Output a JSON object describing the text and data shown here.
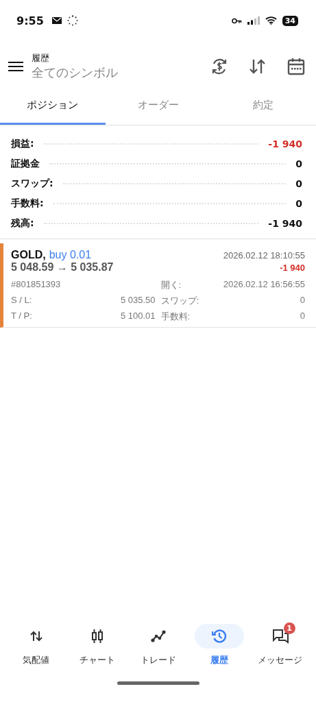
{
  "status_bar": {
    "time": "9:55",
    "battery": "34"
  },
  "header": {
    "title": "履歴",
    "subtitle": "全てのシンボル"
  },
  "tabs": [
    {
      "label": "ポジション",
      "selected": true
    },
    {
      "label": "オーダー",
      "selected": false
    },
    {
      "label": "約定",
      "selected": false
    }
  ],
  "summary": [
    {
      "label": "損益:",
      "value": "-1 940",
      "kind": "loss"
    },
    {
      "label": "証拠金",
      "value": "0",
      "kind": "plain"
    },
    {
      "label": "スワップ:",
      "value": "0",
      "kind": "plain"
    },
    {
      "label": "手数料:",
      "value": "0",
      "kind": "plain"
    },
    {
      "label": "残高:",
      "value": "-1 940",
      "kind": "plain"
    }
  ],
  "deals": [
    {
      "symbol": "GOLD,",
      "side": "buy 0.01",
      "prices": "5 048.59 → 5 035.87",
      "close_time": "2026.02.12 18:10:55",
      "profit": "-1 940",
      "ticket": "#801851393",
      "open_label": "開く:",
      "open_time": "2026.02.12 16:56:55",
      "sl_label": "S / L:",
      "sl": "5 035.50",
      "swap_label": "スワップ:",
      "swap": "0",
      "tp_label": "T / P:",
      "tp": "5 100.01",
      "fee_label": "手数料:",
      "fee": "0"
    }
  ],
  "nav": [
    {
      "label": "気配値",
      "kind": "quotes",
      "selected": false
    },
    {
      "label": "チャート",
      "kind": "chart",
      "selected": false
    },
    {
      "label": "トレード",
      "kind": "trade",
      "selected": false
    },
    {
      "label": "履歴",
      "kind": "history",
      "selected": true
    },
    {
      "label": "メッセージ",
      "kind": "messages",
      "selected": false,
      "badge": "1"
    }
  ]
}
